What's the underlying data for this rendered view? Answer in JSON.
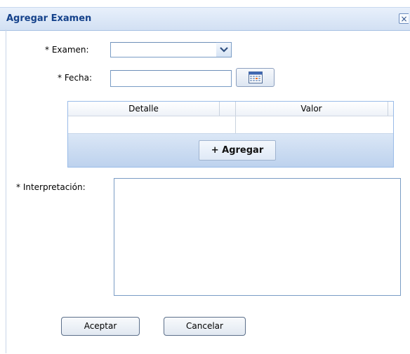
{
  "window": {
    "title": "Agregar Examen",
    "close_symbol": "×"
  },
  "form": {
    "examen": {
      "label": "* Examen:",
      "value": ""
    },
    "fecha": {
      "label": "* Fecha:",
      "value": ""
    },
    "interpretacion": {
      "label": "* Interpretación:",
      "value": ""
    }
  },
  "grid": {
    "columns": [
      "Detalle",
      "Valor"
    ],
    "add_label": "+ Agregar"
  },
  "buttons": {
    "accept": "Aceptar",
    "cancel": "Cancelar"
  },
  "icons": {
    "dropdown": "chevron-down-icon",
    "calendar": "calendar-icon",
    "close": "close-icon"
  },
  "colors": {
    "title": "#15428b",
    "border": "#7a9cc5",
    "toolbar": "#c6d9f0"
  }
}
